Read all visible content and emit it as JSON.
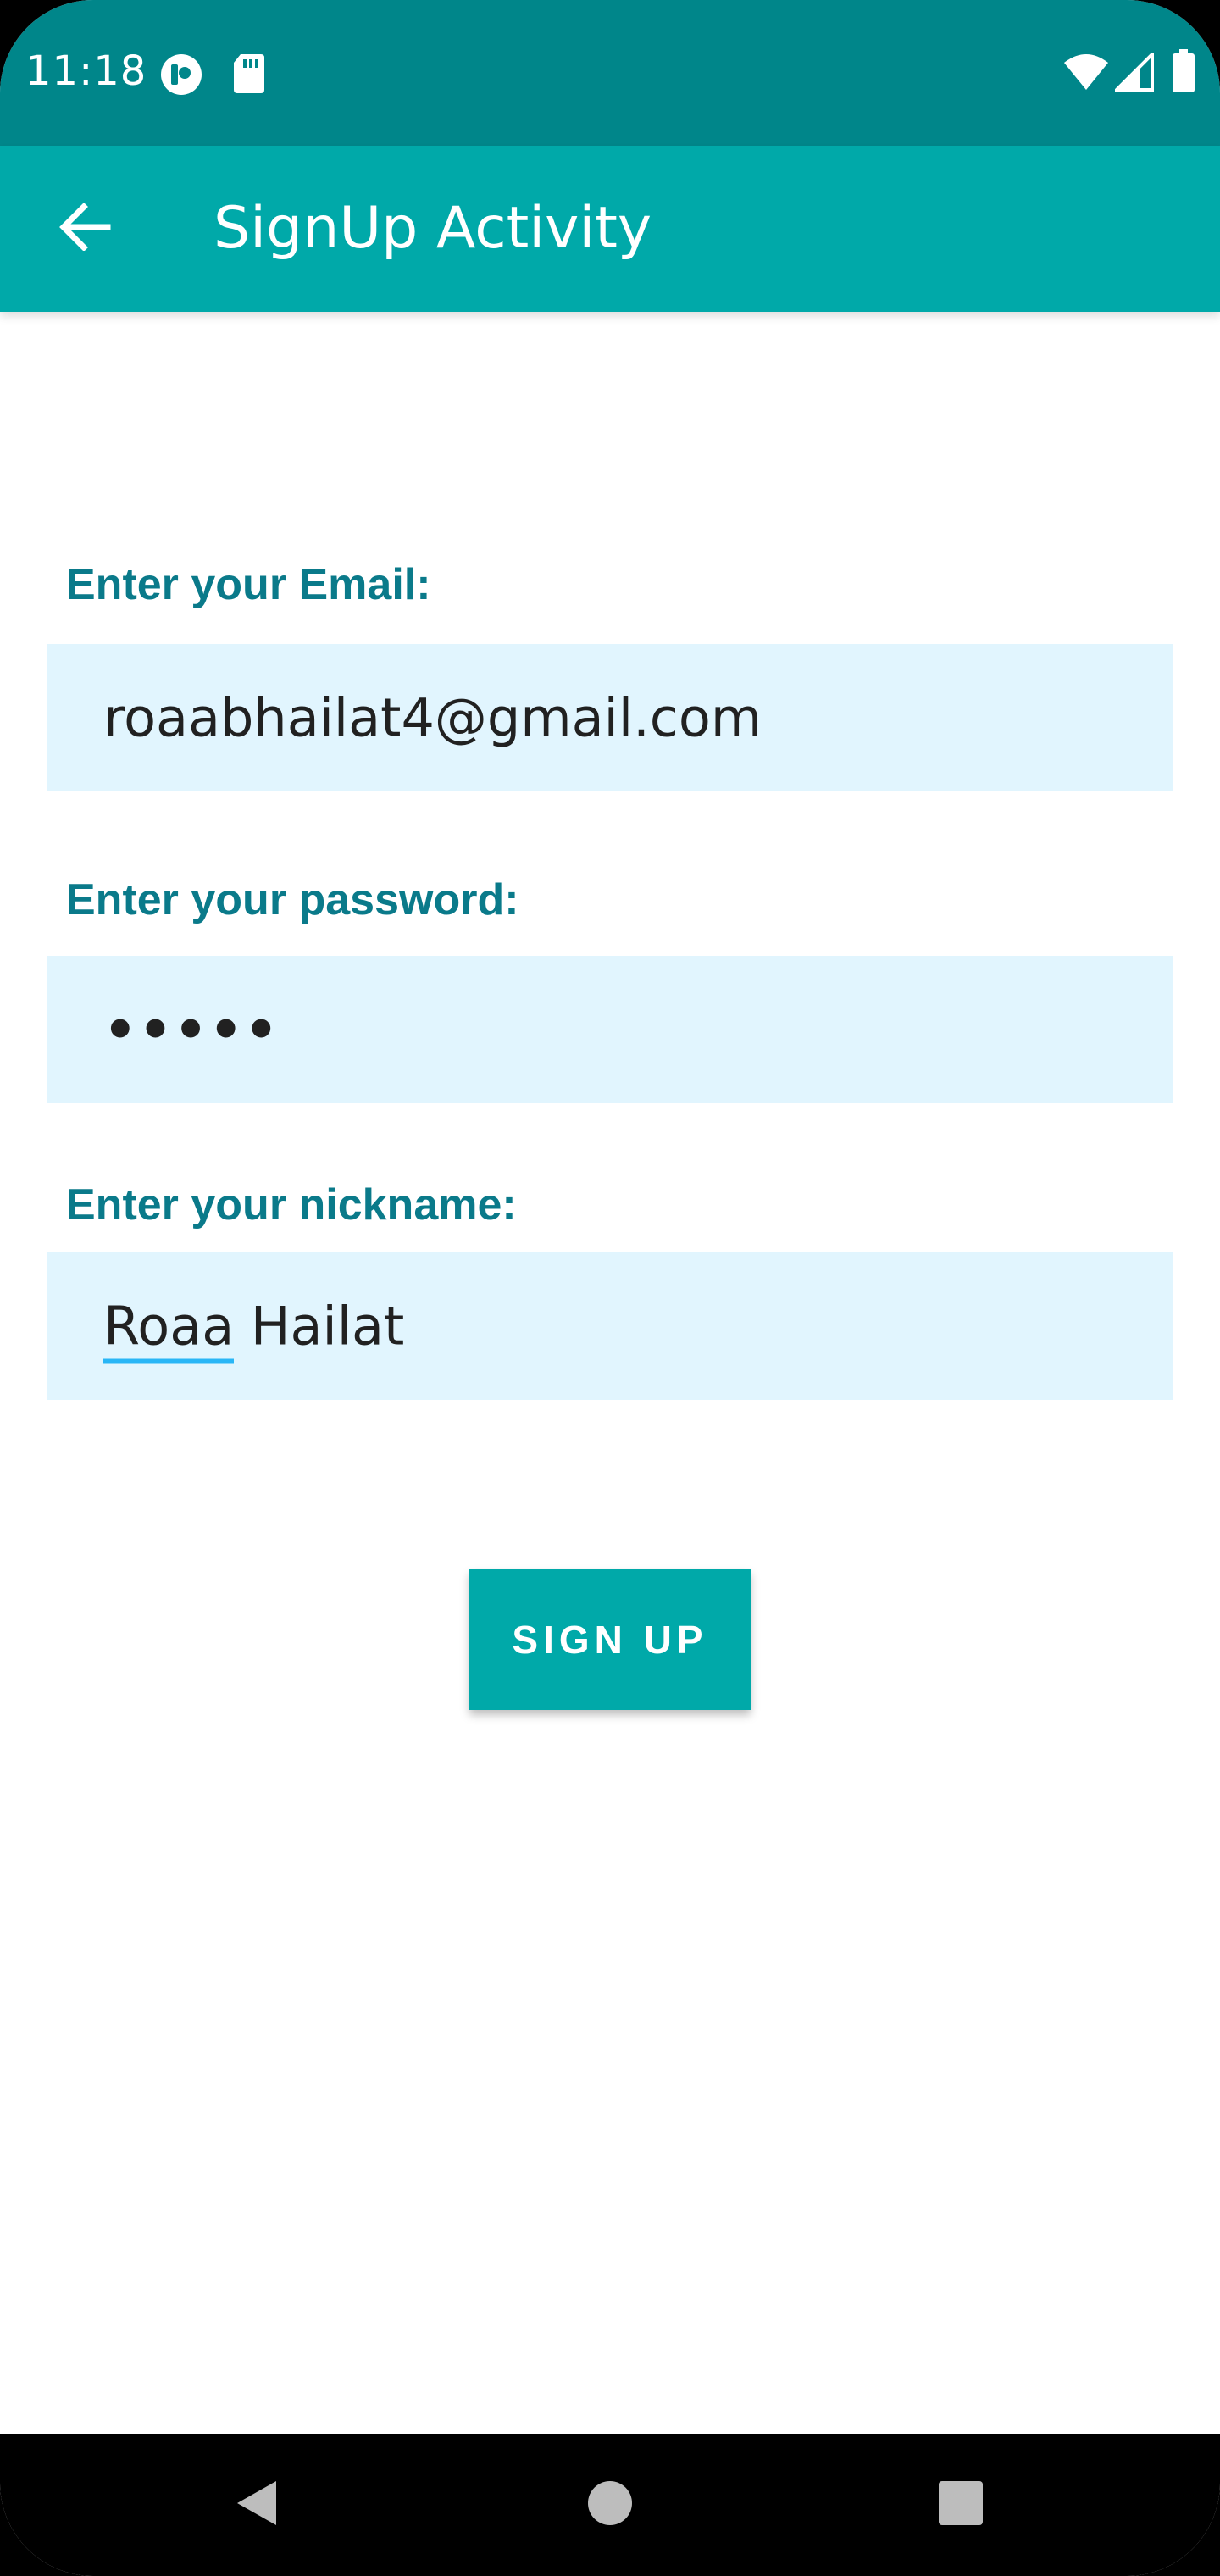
{
  "status_bar": {
    "time": "11:18",
    "icons_left": [
      "app-notification-icon",
      "sd-card-icon"
    ],
    "icons_right": [
      "wifi-icon",
      "cell-signal-icon",
      "battery-icon"
    ]
  },
  "app_bar": {
    "back_icon": "arrow-back-icon",
    "title": "SignUp Activity"
  },
  "form": {
    "email": {
      "label": "Enter your Email:",
      "value": "roaabhailat4@gmail.com"
    },
    "password": {
      "label": "Enter your password:",
      "value": "•••••"
    },
    "nickname": {
      "label": "Enter your nickname:",
      "value_first": "Roaa",
      "value_rest": " Hailat"
    },
    "submit_label": "SIGN UP"
  },
  "colors": {
    "status_bar": "#00868a",
    "app_bar": "#00a9a9",
    "label": "#0a7a8a",
    "field_bg": "#e1f5fe",
    "button": "#00a9a9"
  },
  "nav_bar": {
    "icons": [
      "back-triangle-icon",
      "home-circle-icon",
      "recents-square-icon"
    ]
  }
}
